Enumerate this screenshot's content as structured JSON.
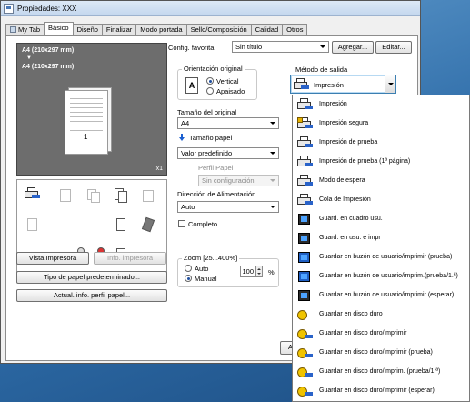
{
  "window": {
    "title": "Propiedades: XXX"
  },
  "tabs": [
    {
      "label": "My Tab",
      "active": false
    },
    {
      "label": "Básico",
      "active": true
    },
    {
      "label": "Diseño",
      "active": false
    },
    {
      "label": "Finalizar",
      "active": false
    },
    {
      "label": "Modo portada",
      "active": false
    },
    {
      "label": "Sello/Composición",
      "active": false
    },
    {
      "label": "Calidad",
      "active": false
    },
    {
      "label": "Otros",
      "active": false
    }
  ],
  "preview": {
    "label_top": "A4 (210x297 mm)",
    "arrow": "▼",
    "label_bottom": "A4 (210x297 mm)",
    "page_number": "1",
    "copies": "x1"
  },
  "left_buttons": {
    "vista_impresora": "Vista Impresora",
    "info_impresora": "Info. impresora",
    "tipo_papel": "Tipo de papel predeterminado...",
    "actual_info": "Actual. info. perfil papel..."
  },
  "favorites": {
    "label": "Config. favorita",
    "value": "Sin título",
    "add_button": "Agregar...",
    "edit_button": "Editar..."
  },
  "orientation": {
    "group_title": "Orientación original",
    "icon_letter": "A",
    "options": [
      "Vertical",
      "Apaisado"
    ],
    "selected": "Vertical"
  },
  "original_size": {
    "label": "Tamaño del original",
    "value": "A4"
  },
  "paper_size": {
    "label": "Tamaño papel",
    "value": "Valor predefinido"
  },
  "paper_profile": {
    "label": "Perfil Papel",
    "value": "Sin configuración",
    "enabled": false
  },
  "feed_direction": {
    "label": "Dirección de Alimentación",
    "value": "Auto"
  },
  "complete": {
    "label": "Completo",
    "checked": false
  },
  "zoom": {
    "group_title": "Zoom [25...400%]",
    "options": [
      "Auto",
      "Manual"
    ],
    "selected": "Manual",
    "value": "100",
    "unit": "%"
  },
  "output_method": {
    "label": "Método de salida",
    "selected": "Impresión",
    "items": [
      "Impresión",
      "Impresión segura",
      "Impresión de prueba",
      "Impresión de prueba (1ª página)",
      "Modo de espera",
      "Cola de Impresión",
      "Guard. en cuadro usu.",
      "Guard. en usu. e impr",
      "Guardar en buzón de usuario/imprimir (prueba)",
      "Guardar en buzón de usuario/imprim.(prueba/1.ª)",
      "Guardar en buzón de usuario/imprimir (esperar)",
      "Guardar en disco duro",
      "Guardar en disco duro/imprimir",
      "Guardar en disco duro/imprimir (prueba)",
      "Guardar en disco duro/imprim. (prueba/1.ª)",
      "Guardar en disco duro/imprimir (esperar)"
    ]
  },
  "footer": {
    "partial_button": "Ac"
  },
  "colors": {
    "accent": "#2a63c9",
    "desktop": "#2d6ba7",
    "focus_border": "#3c7fb1"
  }
}
